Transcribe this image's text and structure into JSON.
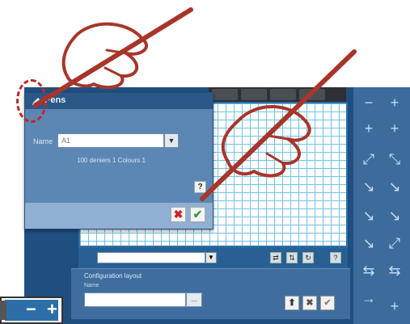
{
  "dialog": {
    "title": "Pens",
    "name_label": "Name",
    "name_value": "A1",
    "info": "100 deniers   1 Colours   1",
    "help": "?",
    "cancel": "✖",
    "ok": "✔"
  },
  "config": {
    "title": "Configuration layout",
    "label": "Name",
    "button": "..."
  },
  "right_panel": {
    "buttons": [
      "−",
      "+",
      "+",
      "+",
      "⤢",
      "⤡",
      "↘",
      "↘",
      "↘",
      "↘",
      "↘",
      "⤢",
      "⇆",
      "⇆",
      "→",
      "+"
    ]
  },
  "toolbar": {
    "icons": [
      "⇄",
      "⇅",
      "↻",
      "?"
    ],
    "config_buttons": [
      "⬆",
      "✖",
      "✔"
    ]
  },
  "zoom": {
    "minus": "−",
    "plus": "+"
  },
  "colors": {
    "accent": "#2c6fa8",
    "highlight": "#c0282c",
    "hand": "#a8352a"
  }
}
